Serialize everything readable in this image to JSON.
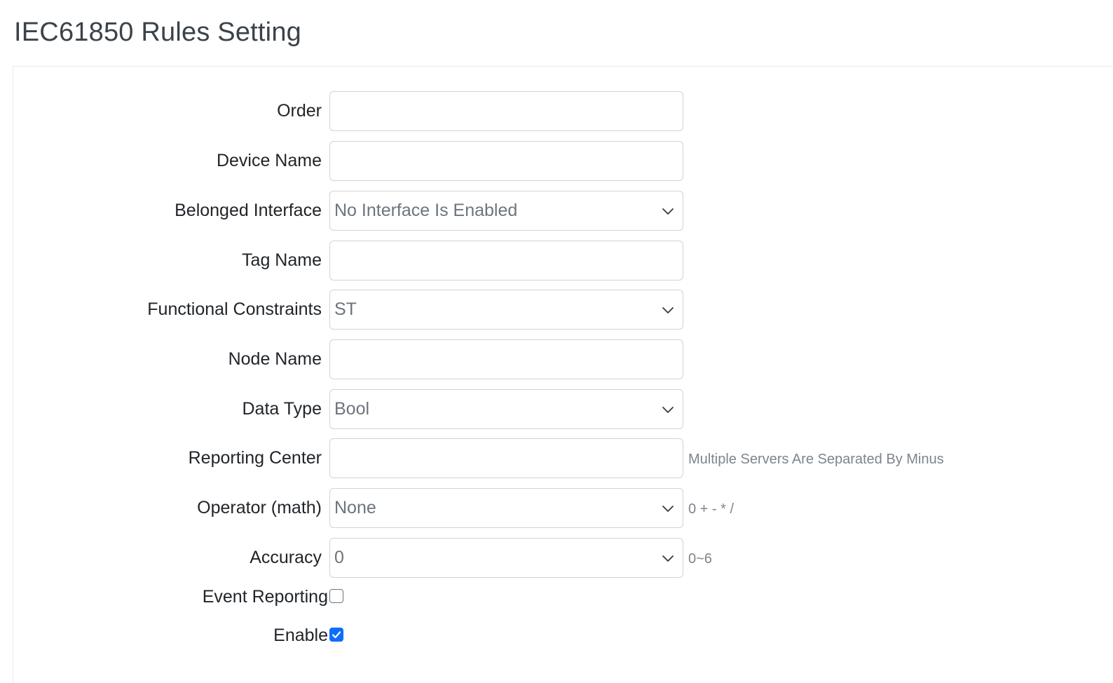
{
  "page": {
    "title": "IEC61850 Rules Setting"
  },
  "form": {
    "order": {
      "label": "Order",
      "value": ""
    },
    "device_name": {
      "label": "Device Name",
      "value": ""
    },
    "belonged_interface": {
      "label": "Belonged Interface",
      "selected": "No Interface Is Enabled"
    },
    "tag_name": {
      "label": "Tag Name",
      "value": ""
    },
    "functional_constraints": {
      "label": "Functional Constraints",
      "selected": "ST"
    },
    "node_name": {
      "label": "Node Name",
      "value": ""
    },
    "data_type": {
      "label": "Data Type",
      "selected": "Bool"
    },
    "reporting_center": {
      "label": "Reporting Center",
      "value": "",
      "hint": "Multiple Servers Are Separated By Minus"
    },
    "operator": {
      "label": "Operator (math)",
      "selected": "None",
      "hint": "0 + - * /"
    },
    "accuracy": {
      "label": "Accuracy",
      "selected": "0",
      "hint": "0~6"
    },
    "event_reporting": {
      "label": "Event Reporting",
      "checked": false
    },
    "enable": {
      "label": "Enable",
      "checked": true
    }
  },
  "colors": {
    "accent": "#0d6efd",
    "border": "#ced4da",
    "hint_text": "#7d858c",
    "select_text": "#6c757d"
  },
  "icons": {
    "select_arrow": "chevron-down-icon",
    "checkmark": "checkmark-icon"
  }
}
